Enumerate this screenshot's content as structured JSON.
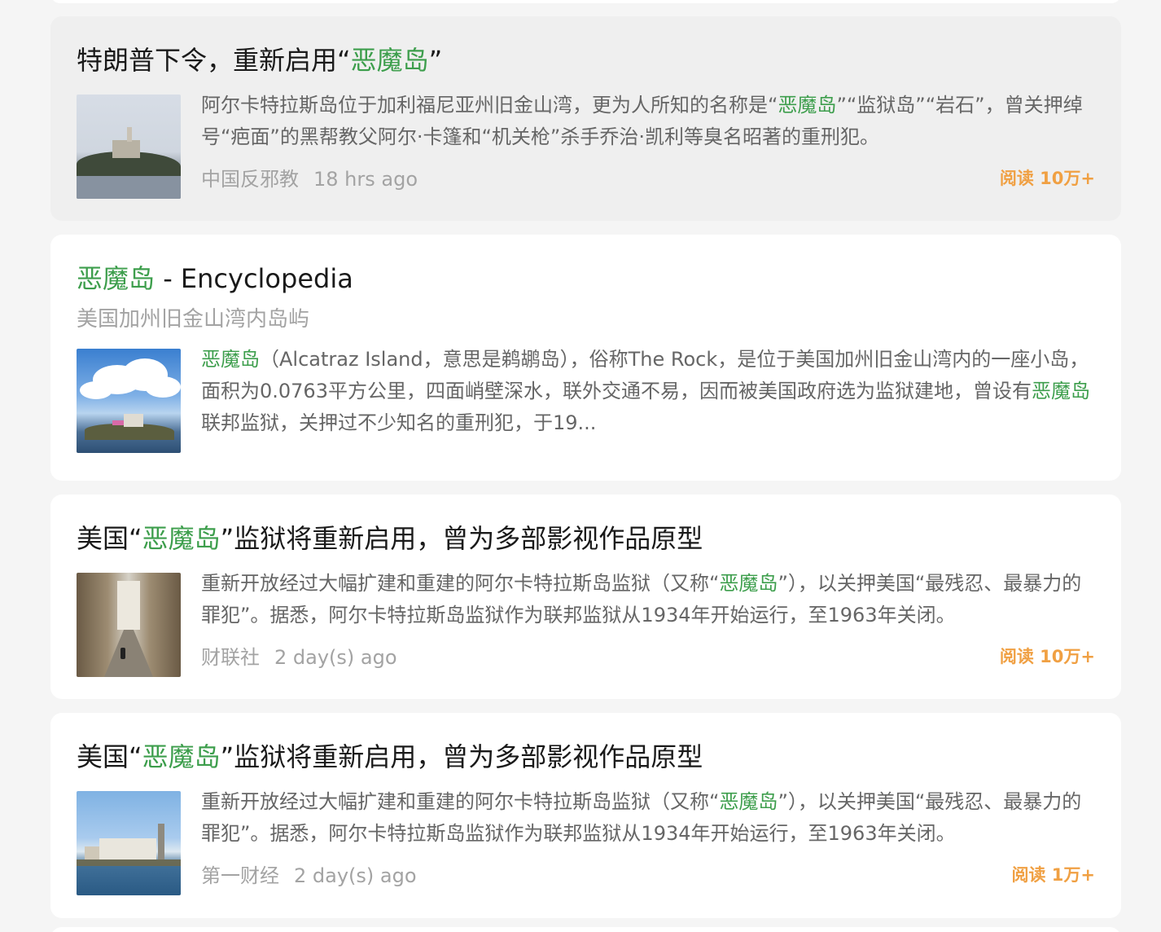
{
  "results": [
    {
      "title_pre": "特朗普下令，重新启用“",
      "title_hl": "恶魔岛",
      "title_post": "”",
      "thumb_icon": "alcatraz-island-photo",
      "snippet_pre": "阿尔卡特拉斯岛位于加利福尼亚州旧金山湾，更为人所知的名称是“",
      "snippet_hl": "恶魔岛",
      "snippet_post": "”“监狱岛”“岩石”，曾关押绰号“疤面”的黑帮教父阿尔·卡篷和“机关枪”杀手乔治·凯利等臭名昭著的重刑犯。",
      "source": "中国反邪教",
      "time": "18 hrs ago",
      "reads": "阅读 10万+"
    },
    {
      "title_hl": "恶魔岛",
      "title_post": " - Encyclopedia",
      "subtitle": "美国加州旧金山湾内岛屿",
      "thumb_icon": "alcatraz-island-sky-photo",
      "snippet_hl": "恶魔岛",
      "snippet_mid": "（Alcatraz Island，意思是鹈鹕岛），俗称The Rock，是位于美国加州旧金山湾内的一座小岛，面积为0.0763平方公里，四面峭壁深水，联外交通不易，因而被美国政府选为监狱建地，曾设有",
      "snippet_hl2": "恶魔岛",
      "snippet_post": "联邦监狱，关押过不少知名的重刑犯，于19..."
    },
    {
      "title_pre": "美国“",
      "title_hl": "恶魔岛",
      "title_post": "”监狱将重新启用，曾为多部影视作品原型",
      "thumb_icon": "prison-cellblock-photo",
      "snippet_pre": "重新开放经过大幅扩建和重建的阿尔卡特拉斯岛监狱（又称“",
      "snippet_hl": "恶魔岛",
      "snippet_post": "”），以关押美国“最残忍、最暴力的罪犯”。据悉，阿尔卡特拉斯岛监狱作为联邦监狱从1934年开始运行，至1963年关闭。",
      "source": "财联社",
      "time": "2 day(s) ago",
      "reads": "阅读 10万+"
    },
    {
      "title_pre": "美国“",
      "title_hl": "恶魔岛",
      "title_post": "”监狱将重新启用，曾为多部影视作品原型",
      "thumb_icon": "alcatraz-waterfront-photo",
      "snippet_pre": "重新开放经过大幅扩建和重建的阿尔卡特拉斯岛监狱（又称“",
      "snippet_hl": "恶魔岛",
      "snippet_post": "”），以关押美国“最残忍、最暴力的罪犯”。据悉，阿尔卡特拉斯岛监狱作为联邦监狱从1934年开始运行，至1963年关闭。",
      "source": "第一财经",
      "time": "2 day(s) ago",
      "reads": "阅读 1万+"
    }
  ],
  "colors": {
    "highlight": "#3d9e4c",
    "reads": "#f0a043",
    "muted": "#a3a3a3"
  }
}
